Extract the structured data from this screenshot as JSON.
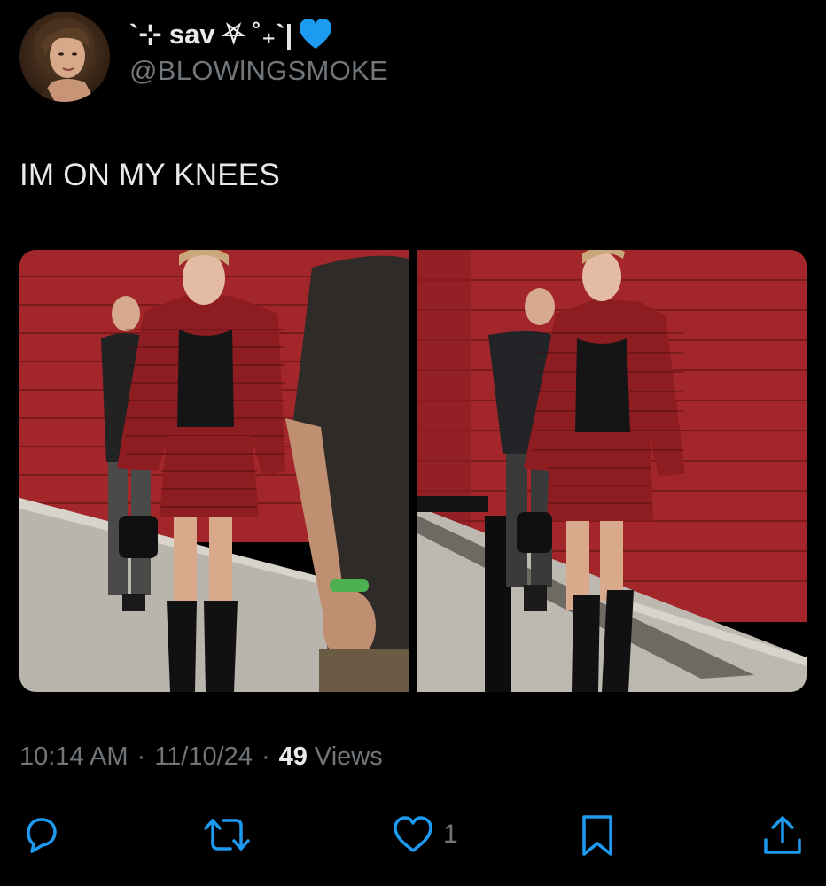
{
  "author": {
    "display_name": "`⊹ sav ⛧ ˚₊`|",
    "emoji": "blue-heart",
    "handle": "@BLOWlNGSMOKE",
    "avatar": "profile-photo"
  },
  "tweet": {
    "text": "IM ON MY KNEES",
    "media": [
      {
        "alt": "photo-1"
      },
      {
        "alt": "photo-2"
      }
    ]
  },
  "meta": {
    "time": "10:14 AM",
    "separator": "·",
    "date": "11/10/24",
    "views_count": "49",
    "views_label": "Views"
  },
  "actions": {
    "reply_icon": "reply-icon",
    "retweet_icon": "retweet-icon",
    "like_icon": "heart-icon",
    "like_count": "1",
    "bookmark_icon": "bookmark-icon",
    "share_icon": "share-icon"
  },
  "colors": {
    "background": "#000000",
    "text": "#e7e9ea",
    "secondary": "#71767b",
    "heart_blue": "#1d9bf0"
  }
}
